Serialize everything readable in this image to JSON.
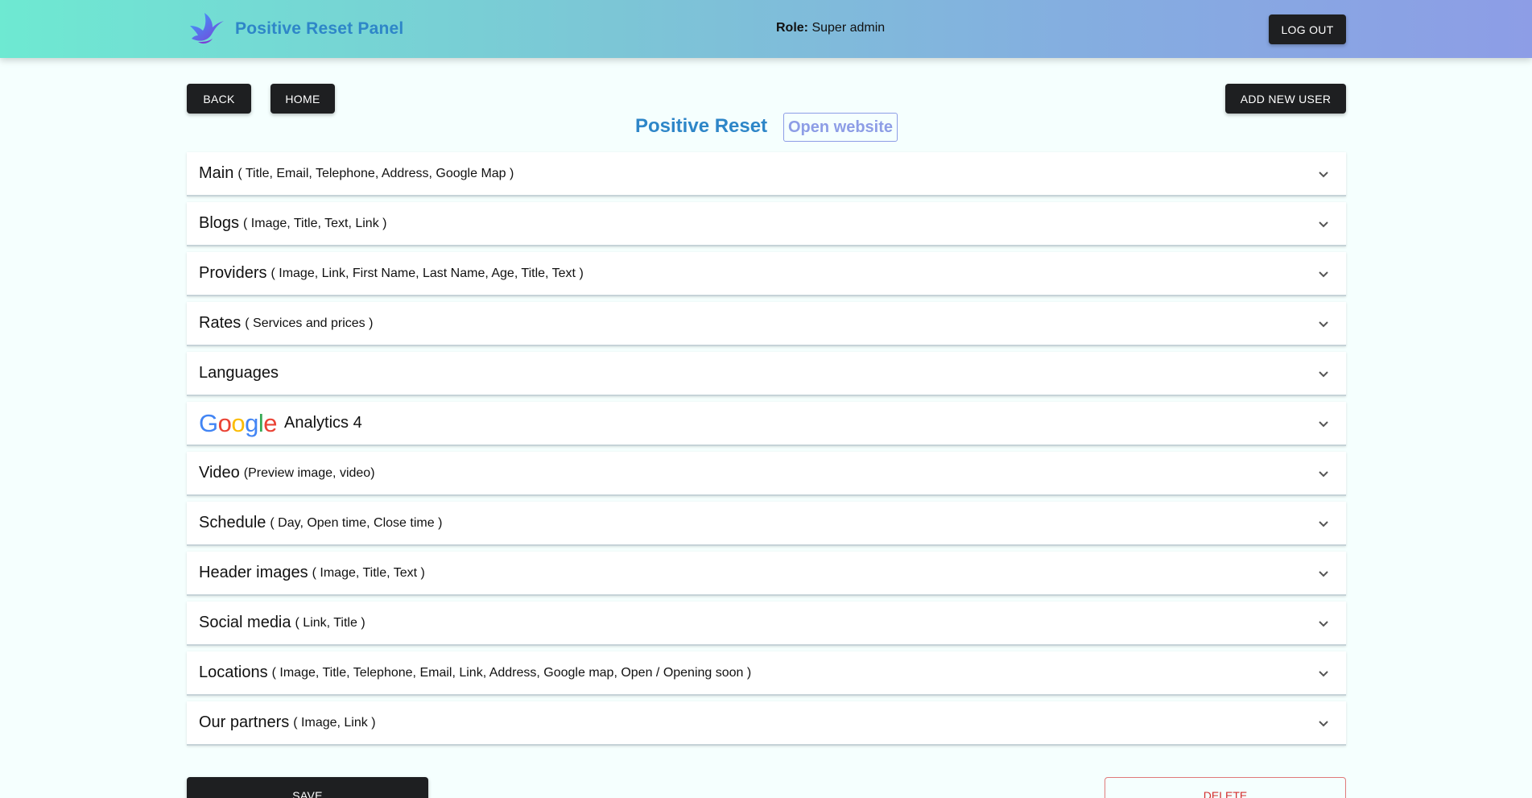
{
  "header": {
    "brand": "Positive Reset Panel",
    "role_label": "Role:",
    "role_value": "Super admin",
    "logout_label": "LOG OUT"
  },
  "toolbar": {
    "back_label": "BACK",
    "home_label": "HOME",
    "add_user_label": "ADD NEW USER"
  },
  "site": {
    "title": "Positive Reset",
    "open_website_label": "Open website"
  },
  "sections": [
    {
      "title": "Main",
      "subtitle": "( Title, Email, Telephone, Address, Google Map )"
    },
    {
      "title": "Blogs",
      "subtitle": "( Image, Title, Text, Link )"
    },
    {
      "title": "Providers",
      "subtitle": "( Image, Link, First Name, Last Name, Age, Title, Text )"
    },
    {
      "title": "Rates",
      "subtitle": "( Services and prices )"
    },
    {
      "title": "Languages",
      "subtitle": ""
    },
    {
      "title": "Analytics 4",
      "subtitle": "",
      "logo": "Google"
    },
    {
      "title": "Video",
      "subtitle": "(Preview image, video)"
    },
    {
      "title": "Schedule",
      "subtitle": "( Day, Open time, Close time )"
    },
    {
      "title": "Header images",
      "subtitle": "( Image, Title, Text )"
    },
    {
      "title": "Social media",
      "subtitle": "( Link, Title )"
    },
    {
      "title": "Locations",
      "subtitle": "( Image, Title, Telephone, Email, Link, Address, Google map, Open / Opening soon )"
    },
    {
      "title": "Our partners",
      "subtitle": "( Image, Link )"
    }
  ],
  "footer": {
    "save_label": "SAVE",
    "delete_label": "DELETE"
  },
  "colors": {
    "accent": "#2e86c8",
    "secondary": "#8d9de6",
    "button_dark": "#1e1f21",
    "danger": "#d32f2f"
  },
  "icons": {
    "brand_logo": "bird-logo-icon",
    "expand": "chevron-down-icon"
  }
}
